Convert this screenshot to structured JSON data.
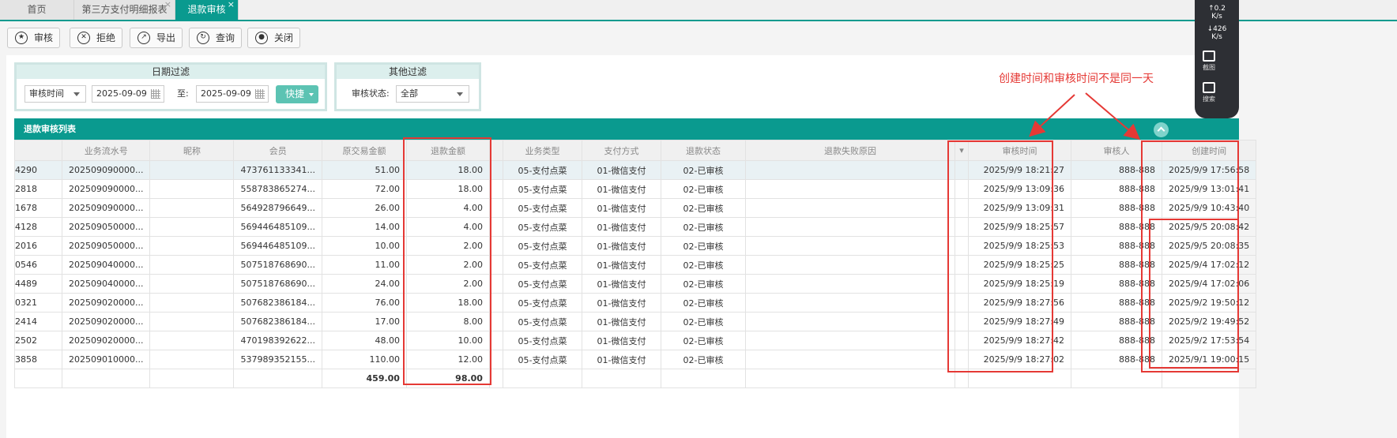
{
  "tabs": [
    {
      "label": "首页",
      "closable": false,
      "active": false
    },
    {
      "label": "第三方支付明细报表",
      "closable": true,
      "active": false
    },
    {
      "label": "退款审核",
      "closable": true,
      "active": true
    }
  ],
  "toolbar": {
    "approve": "审核",
    "reject": "拒绝",
    "export": "导出",
    "query": "查询",
    "close": "关闭"
  },
  "date_filter": {
    "title": "日期过滤",
    "date_type": "审核时间",
    "start_date": "2025-09-09",
    "to_label": "至:",
    "end_date": "2025-09-09",
    "quick_label": "快捷"
  },
  "other_filter": {
    "title": "其他过滤",
    "status_label": "审核状态:",
    "status_value": "全部"
  },
  "list": {
    "title": "退款审核列表",
    "columns": [
      "业务流水号",
      "昵称",
      "会员",
      "原交易金额",
      "退款金额",
      "业务类型",
      "支付方式",
      "退款状态",
      "退款失败原因",
      "审核时间",
      "审核人",
      "创建时间"
    ],
    "rows": [
      {
        "code": "4290",
        "serial": "202509090000...",
        "nick": "",
        "member": "473761133341...",
        "orig": "51.00",
        "refund": "18.00",
        "btype": "05-支付点菜",
        "pay": "01-微信支付",
        "status": "02-已审核",
        "reason": "",
        "audit_time": "2025/9/9 18:21:27",
        "auditor": "888-888",
        "created": "2025/9/9 17:56:58"
      },
      {
        "code": "2818",
        "serial": "202509090000...",
        "nick": "",
        "member": "558783865274...",
        "orig": "72.00",
        "refund": "18.00",
        "btype": "05-支付点菜",
        "pay": "01-微信支付",
        "status": "02-已审核",
        "reason": "",
        "audit_time": "2025/9/9 13:09:36",
        "auditor": "888-888",
        "created": "2025/9/9 13:01:41"
      },
      {
        "code": "1678",
        "serial": "202509090000...",
        "nick": "",
        "member": "564928796649...",
        "orig": "26.00",
        "refund": "4.00",
        "btype": "05-支付点菜",
        "pay": "01-微信支付",
        "status": "02-已审核",
        "reason": "",
        "audit_time": "2025/9/9 13:09:31",
        "auditor": "888-888",
        "created": "2025/9/9 10:43:40"
      },
      {
        "code": "4128",
        "serial": "202509050000...",
        "nick": "",
        "member": "569446485109...",
        "orig": "14.00",
        "refund": "4.00",
        "btype": "05-支付点菜",
        "pay": "01-微信支付",
        "status": "02-已审核",
        "reason": "",
        "audit_time": "2025/9/9 18:25:57",
        "auditor": "888-888",
        "created": "2025/9/5 20:08:42"
      },
      {
        "code": "2016",
        "serial": "202509050000...",
        "nick": "",
        "member": "569446485109...",
        "orig": "10.00",
        "refund": "2.00",
        "btype": "05-支付点菜",
        "pay": "01-微信支付",
        "status": "02-已审核",
        "reason": "",
        "audit_time": "2025/9/9 18:25:53",
        "auditor": "888-888",
        "created": "2025/9/5 20:08:35"
      },
      {
        "code": "0546",
        "serial": "202509040000...",
        "nick": "",
        "member": "507518768690...",
        "orig": "11.00",
        "refund": "2.00",
        "btype": "05-支付点菜",
        "pay": "01-微信支付",
        "status": "02-已审核",
        "reason": "",
        "audit_time": "2025/9/9 18:25:25",
        "auditor": "888-888",
        "created": "2025/9/4 17:02:12"
      },
      {
        "code": "4489",
        "serial": "202509040000...",
        "nick": "",
        "member": "507518768690...",
        "orig": "24.00",
        "refund": "2.00",
        "btype": "05-支付点菜",
        "pay": "01-微信支付",
        "status": "02-已审核",
        "reason": "",
        "audit_time": "2025/9/9 18:25:19",
        "auditor": "888-888",
        "created": "2025/9/4 17:02:06"
      },
      {
        "code": "0321",
        "serial": "202509020000...",
        "nick": "",
        "member": "507682386184...",
        "orig": "76.00",
        "refund": "18.00",
        "btype": "05-支付点菜",
        "pay": "01-微信支付",
        "status": "02-已审核",
        "reason": "",
        "audit_time": "2025/9/9 18:27:56",
        "auditor": "888-888",
        "created": "2025/9/2 19:50:12"
      },
      {
        "code": "2414",
        "serial": "202509020000...",
        "nick": "",
        "member": "507682386184...",
        "orig": "17.00",
        "refund": "8.00",
        "btype": "05-支付点菜",
        "pay": "01-微信支付",
        "status": "02-已审核",
        "reason": "",
        "audit_time": "2025/9/9 18:27:49",
        "auditor": "888-888",
        "created": "2025/9/2 19:49:52"
      },
      {
        "code": "2502",
        "serial": "202509020000...",
        "nick": "",
        "member": "470198392622...",
        "orig": "48.00",
        "refund": "10.00",
        "btype": "05-支付点菜",
        "pay": "01-微信支付",
        "status": "02-已审核",
        "reason": "",
        "audit_time": "2025/9/9 18:27:42",
        "auditor": "888-888",
        "created": "2025/9/2 17:53:54"
      },
      {
        "code": "3858",
        "serial": "202509010000...",
        "nick": "",
        "member": "537989352155...",
        "orig": "110.00",
        "refund": "12.00",
        "btype": "05-支付点菜",
        "pay": "01-微信支付",
        "status": "02-已审核",
        "reason": "",
        "audit_time": "2025/9/9 18:27:02",
        "auditor": "888-888",
        "created": "2025/9/1 19:00:15"
      }
    ],
    "totals": {
      "orig": "459.00",
      "refund": "98.00"
    }
  },
  "annotation": "创建时间和审核时间不是同一天",
  "sidebar": {
    "upload_speed": "0.2",
    "download_speed": "426",
    "unit": "K/s",
    "screenshot_label": "截图",
    "search_label": "搜索"
  },
  "colors": {
    "accent": "#0a9a8f",
    "annotation": "#e53935"
  }
}
